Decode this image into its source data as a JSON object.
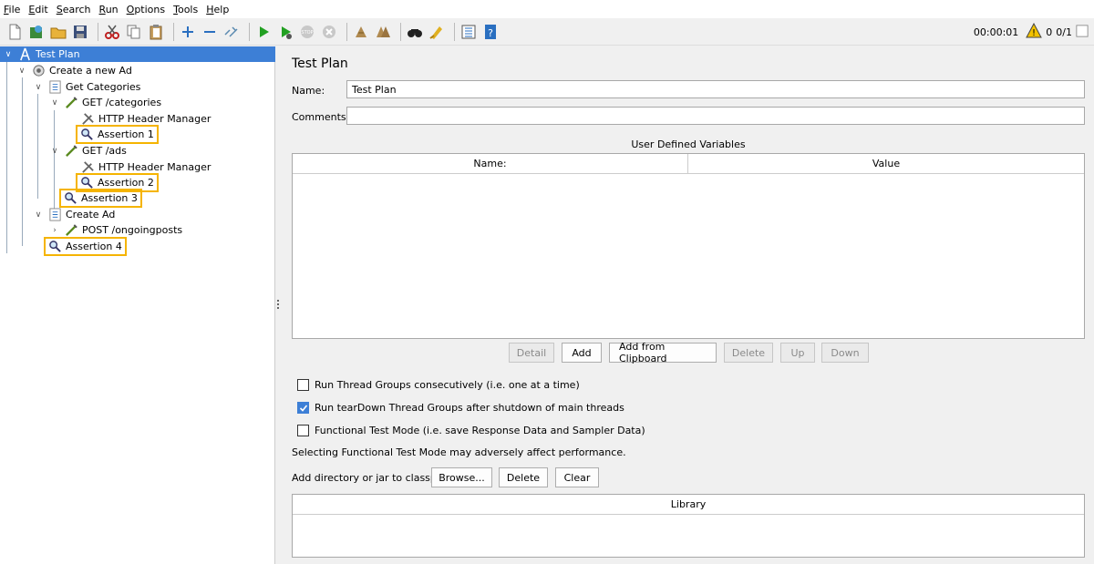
{
  "menu": {
    "items": [
      {
        "first": "F",
        "rest": "ile"
      },
      {
        "first": "E",
        "rest": "dit"
      },
      {
        "first": "S",
        "rest": "earch"
      },
      {
        "first": "R",
        "rest": "un"
      },
      {
        "first": "O",
        "rest": "ptions"
      },
      {
        "first": "T",
        "rest": "ools"
      },
      {
        "first": "H",
        "rest": "elp"
      }
    ]
  },
  "toolbar": {
    "timer": "00:00:01",
    "warning_count": "0",
    "threads": "0/1",
    "icons": [
      "new-icon",
      "templates-icon",
      "open-icon",
      "save-icon",
      "cut-icon",
      "copy-icon",
      "paste-icon",
      "expand-icon",
      "collapse-icon",
      "toggle-icon",
      "start-icon",
      "start-no-pause-icon",
      "stop-icon",
      "shutdown-icon",
      "clear-icon",
      "clear-all-icon",
      "search-icon",
      "reset-search-icon",
      "function-helper-icon",
      "help-icon"
    ]
  },
  "tree": {
    "items": [
      {
        "label": "Test Plan",
        "icon": "test-plan-icon"
      },
      {
        "label": "Create a new Ad",
        "icon": "thread-group-icon"
      },
      {
        "label": "Get Categories",
        "icon": "transaction-controller-icon"
      },
      {
        "label": "GET /categories",
        "icon": "sampler-icon"
      },
      {
        "label": "HTTP Header Manager",
        "icon": "config-icon"
      },
      {
        "label": "Assertion 1",
        "icon": "assertion-icon"
      },
      {
        "label": "GET /ads",
        "icon": "sampler-icon"
      },
      {
        "label": "HTTP Header Manager",
        "icon": "config-icon"
      },
      {
        "label": "Assertion 2",
        "icon": "assertion-icon"
      },
      {
        "label": "Assertion 3",
        "icon": "assertion-icon"
      },
      {
        "label": "Create Ad",
        "icon": "transaction-controller-icon"
      },
      {
        "label": "POST /ongoingposts",
        "icon": "sampler-icon"
      },
      {
        "label": "Assertion 4",
        "icon": "assertion-icon"
      }
    ]
  },
  "main": {
    "title": "Test Plan",
    "name_label": "Name:",
    "name_value": "Test Plan",
    "comments_label": "Comments:",
    "comments_value": "",
    "udv_title": "User Defined Variables",
    "udv_columns": [
      "Name:",
      "Value"
    ],
    "buttons": {
      "detail": "Detail",
      "add": "Add",
      "add_clipboard": "Add from Clipboard",
      "delete": "Delete",
      "up": "Up",
      "down": "Down"
    },
    "checkboxes": [
      {
        "label": "Run Thread Groups consecutively (i.e. one at a time)",
        "checked": false
      },
      {
        "label": "Run tearDown Thread Groups after shutdown of main threads",
        "checked": true
      },
      {
        "label": "Functional Test Mode (i.e. save Response Data and Sampler Data)",
        "checked": false
      }
    ],
    "functional_note": "Selecting Functional Test Mode may adversely affect performance.",
    "classpath_label": "Add directory or jar to classpath",
    "classpath_buttons": {
      "browse": "Browse...",
      "delete": "Delete",
      "clear": "Clear"
    },
    "library_header": "Library"
  },
  "colors": {
    "selection": "#3d7fd6",
    "highlight": "#f5b400"
  }
}
